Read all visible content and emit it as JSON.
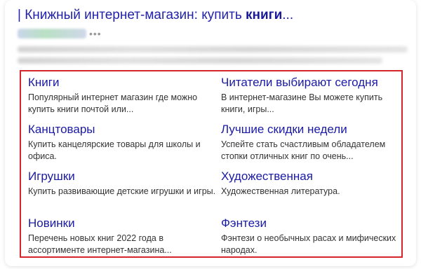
{
  "result": {
    "title_prefix": "| Книжный интернет-магазин: купить ",
    "title_bold": "книги",
    "title_suffix": "...",
    "more_label": "•••"
  },
  "sitelinks": [
    {
      "title": "Книги",
      "desc": "Популярный интернет магазин где можно купить книги почтой или..."
    },
    {
      "title": "Читатели выбирают сегодня",
      "desc": "В интернет-магазине Вы можете купить книги, игры..."
    },
    {
      "title": "Канцтовары",
      "desc": "Купить канцелярские товары для школы и офиса."
    },
    {
      "title": "Лучшие скидки недели",
      "desc": "Успейте стать счастливым обладателем стопки отличных книг по очень..."
    },
    {
      "title": "Игрушки",
      "desc": "Купить развивающие детские игрушки и игры."
    },
    {
      "title": "Художественная",
      "desc": "Художественная литература."
    },
    {
      "title": "Новинки",
      "desc": "Перечень новых книг 2022 года в ассортименте интернет-магазина..."
    },
    {
      "title": "Фэнтези",
      "desc": "Фэнтези о необычных расах и мифических народах."
    }
  ],
  "colors": {
    "link": "#1a1aa6",
    "highlight_border": "#d5252a",
    "text": "#333333"
  }
}
